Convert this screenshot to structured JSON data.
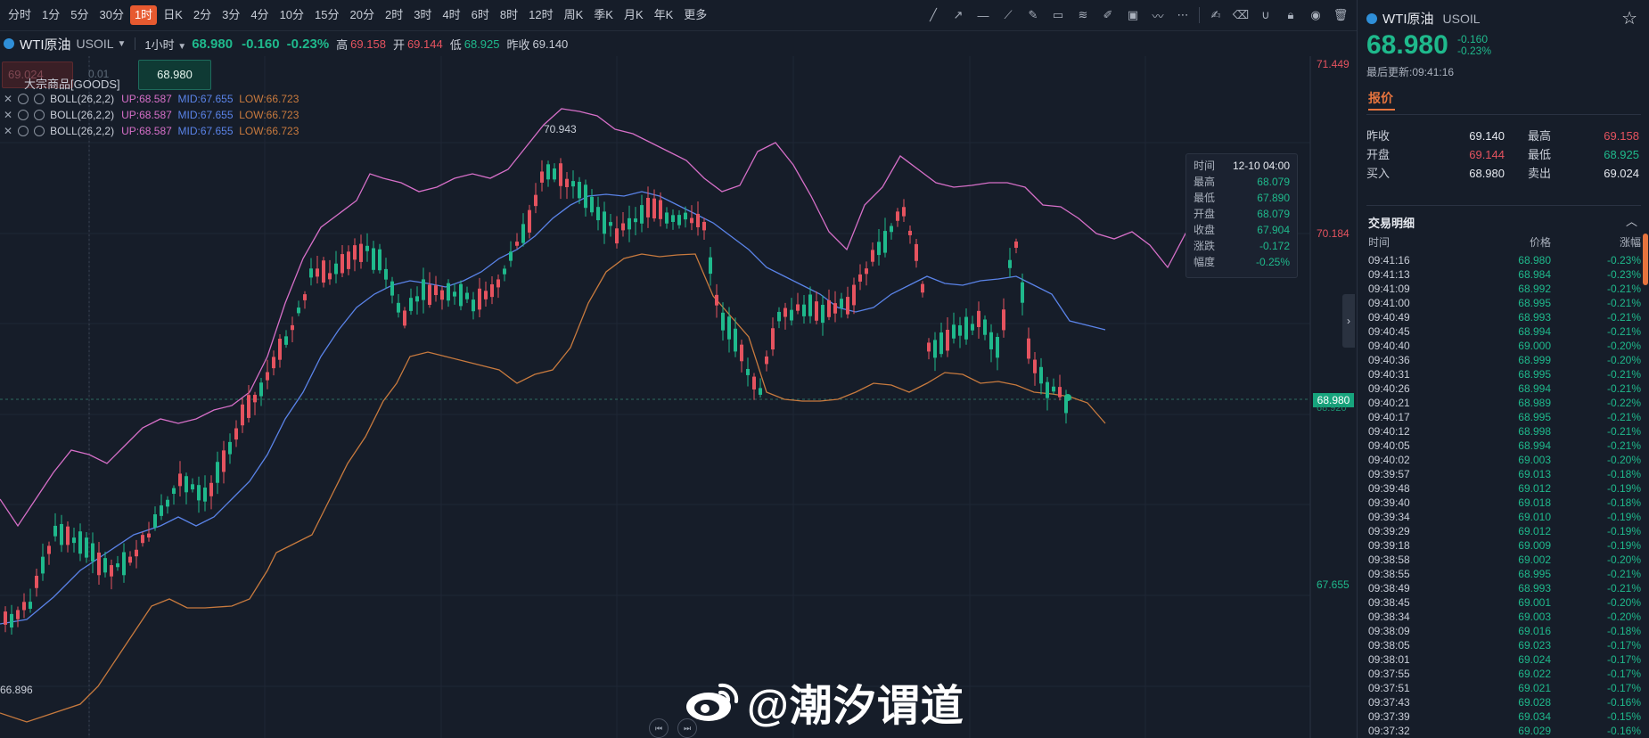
{
  "toolbar": {
    "periods": [
      "分时",
      "1分",
      "5分",
      "30分",
      "1时",
      "日K",
      "2分",
      "3分",
      "4分",
      "10分",
      "15分",
      "20分",
      "2时",
      "3时",
      "4时",
      "6时",
      "8时",
      "12时",
      "周K",
      "季K",
      "月K",
      "年K",
      "更多"
    ],
    "active_period": "1时",
    "tools": [
      "trend-line-icon",
      "ray-icon",
      "horizontal-line-icon",
      "extended-line-icon",
      "pen-icon",
      "measure-icon",
      "fib-fan-icon",
      "brush-icon",
      "image-icon",
      "chart-pattern-icon",
      "more-dots-icon",
      "edit-icon",
      "eraser-icon",
      "magnet-icon",
      "lock-icon",
      "eye-icon",
      "trash-icon"
    ]
  },
  "infobar": {
    "name": "WTI原油",
    "code": "USOIL",
    "interval": "1小时",
    "price": "68.980",
    "change": "-0.160",
    "change_pct": "-0.23%",
    "high_label": "高",
    "high": "69.158",
    "open_label": "开",
    "open": "69.144",
    "low_label": "低",
    "low": "68.925",
    "prev_label": "昨收",
    "prev": "69.140"
  },
  "chart_overlay": {
    "order_sell": "69.024",
    "order_sell2": "0.01",
    "order_buy": "68.980",
    "goods_label": "大宗商品[GOODS]"
  },
  "indicators": [
    {
      "name": "BOLL(26,2,2)",
      "up": "UP:68.587",
      "mid": "MID:67.655",
      "low": "LOW:66.723"
    },
    {
      "name": "BOLL(26,2,2)",
      "up": "UP:68.587",
      "mid": "MID:67.655",
      "low": "LOW:66.723"
    },
    {
      "name": "BOLL(26,2,2)",
      "up": "UP:68.587",
      "mid": "MID:67.655",
      "low": "LOW:66.723"
    }
  ],
  "axis": {
    "y_top": "71.449",
    "y_mid": "70.184",
    "y_low": "67.655",
    "cur_price": "68.980",
    "cur_under": "68.920",
    "peak_label": "70.943",
    "trough_label": "66.896"
  },
  "tooltip": {
    "rows": [
      {
        "k": "时间",
        "v": "12-10 04:00"
      },
      {
        "k": "最高",
        "v": "68.079"
      },
      {
        "k": "最低",
        "v": "67.890"
      },
      {
        "k": "开盘",
        "v": "68.079"
      },
      {
        "k": "收盘",
        "v": "67.904"
      },
      {
        "k": "涨跌",
        "v": "-0.172"
      },
      {
        "k": "幅度",
        "v": "-0.25%"
      }
    ]
  },
  "watermark": "@潮汐谓道",
  "panel": {
    "name": "WTI原油",
    "code": "USOIL",
    "price": "68.980",
    "change": "-0.160",
    "change_pct": "-0.23%",
    "updated": "最后更新:09:41:16",
    "tab": "报价",
    "quotes": [
      {
        "k": "昨收",
        "v": "69.140",
        "vc": "",
        "k2": "最高",
        "v2": "69.158",
        "v2c": "up"
      },
      {
        "k": "开盘",
        "v": "69.144",
        "vc": "up",
        "k2": "最低",
        "v2": "68.925",
        "v2c": "dn"
      },
      {
        "k": "买入",
        "v": "68.980",
        "vc": "",
        "k2": "卖出",
        "v2": "69.024",
        "v2c": ""
      }
    ],
    "trades_title": "交易明细",
    "trades_head": [
      "时间",
      "价格",
      "涨幅"
    ],
    "trades": [
      [
        "09:41:16",
        "68.980",
        "-0.23%"
      ],
      [
        "09:41:13",
        "68.984",
        "-0.23%"
      ],
      [
        "09:41:09",
        "68.992",
        "-0.21%"
      ],
      [
        "09:41:00",
        "68.995",
        "-0.21%"
      ],
      [
        "09:40:49",
        "68.993",
        "-0.21%"
      ],
      [
        "09:40:45",
        "68.994",
        "-0.21%"
      ],
      [
        "09:40:40",
        "69.000",
        "-0.20%"
      ],
      [
        "09:40:36",
        "68.999",
        "-0.20%"
      ],
      [
        "09:40:31",
        "68.995",
        "-0.21%"
      ],
      [
        "09:40:26",
        "68.994",
        "-0.21%"
      ],
      [
        "09:40:21",
        "68.989",
        "-0.22%"
      ],
      [
        "09:40:17",
        "68.995",
        "-0.21%"
      ],
      [
        "09:40:12",
        "68.998",
        "-0.21%"
      ],
      [
        "09:40:05",
        "68.994",
        "-0.21%"
      ],
      [
        "09:40:02",
        "69.003",
        "-0.20%"
      ],
      [
        "09:39:57",
        "69.013",
        "-0.18%"
      ],
      [
        "09:39:48",
        "69.012",
        "-0.19%"
      ],
      [
        "09:39:40",
        "69.018",
        "-0.18%"
      ],
      [
        "09:39:34",
        "69.010",
        "-0.19%"
      ],
      [
        "09:39:29",
        "69.012",
        "-0.19%"
      ],
      [
        "09:39:18",
        "69.009",
        "-0.19%"
      ],
      [
        "09:38:58",
        "69.002",
        "-0.20%"
      ],
      [
        "09:38:55",
        "68.995",
        "-0.21%"
      ],
      [
        "09:38:49",
        "68.993",
        "-0.21%"
      ],
      [
        "09:38:45",
        "69.001",
        "-0.20%"
      ],
      [
        "09:38:34",
        "69.003",
        "-0.20%"
      ],
      [
        "09:38:09",
        "69.016",
        "-0.18%"
      ],
      [
        "09:38:05",
        "69.023",
        "-0.17%"
      ],
      [
        "09:38:01",
        "69.024",
        "-0.17%"
      ],
      [
        "09:37:55",
        "69.022",
        "-0.17%"
      ],
      [
        "09:37:51",
        "69.021",
        "-0.17%"
      ],
      [
        "09:37:43",
        "69.028",
        "-0.16%"
      ],
      [
        "09:37:39",
        "69.034",
        "-0.15%"
      ],
      [
        "09:37:32",
        "69.029",
        "-0.16%"
      ]
    ]
  },
  "colors": {
    "up": "#e5535f",
    "down": "#1fb98c",
    "boll_up": "#d66fc8",
    "boll_mid": "#5a83e8",
    "boll_low": "#c87a3e",
    "accent": "#e7743e"
  }
}
